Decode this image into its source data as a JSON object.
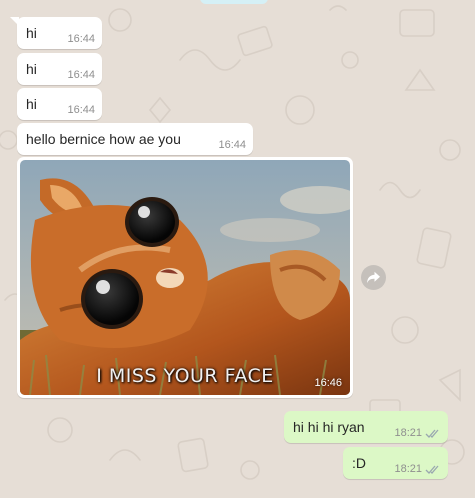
{
  "chat": {
    "incoming": [
      {
        "text": "hi",
        "time": "16:44"
      },
      {
        "text": "hi",
        "time": "16:44"
      },
      {
        "text": "hi",
        "time": "16:44"
      },
      {
        "text": "hello bernice how ae you",
        "time": "16:44"
      }
    ],
    "media": {
      "caption": "I MISS YOUR FACE",
      "time": "16:46"
    },
    "outgoing": [
      {
        "text": "hi hi hi ryan",
        "time": "18:21"
      },
      {
        "text": ":D",
        "time": "18:21"
      }
    ]
  },
  "colors": {
    "wallpaper": "#e6ded6",
    "incoming_bubble": "#ffffff",
    "outgoing_bubble": "#dcf8c6",
    "read_ticks": "#9aa8b0"
  },
  "icons": {
    "forward": "forward-arrow-icon",
    "status": "double-check-icon"
  }
}
